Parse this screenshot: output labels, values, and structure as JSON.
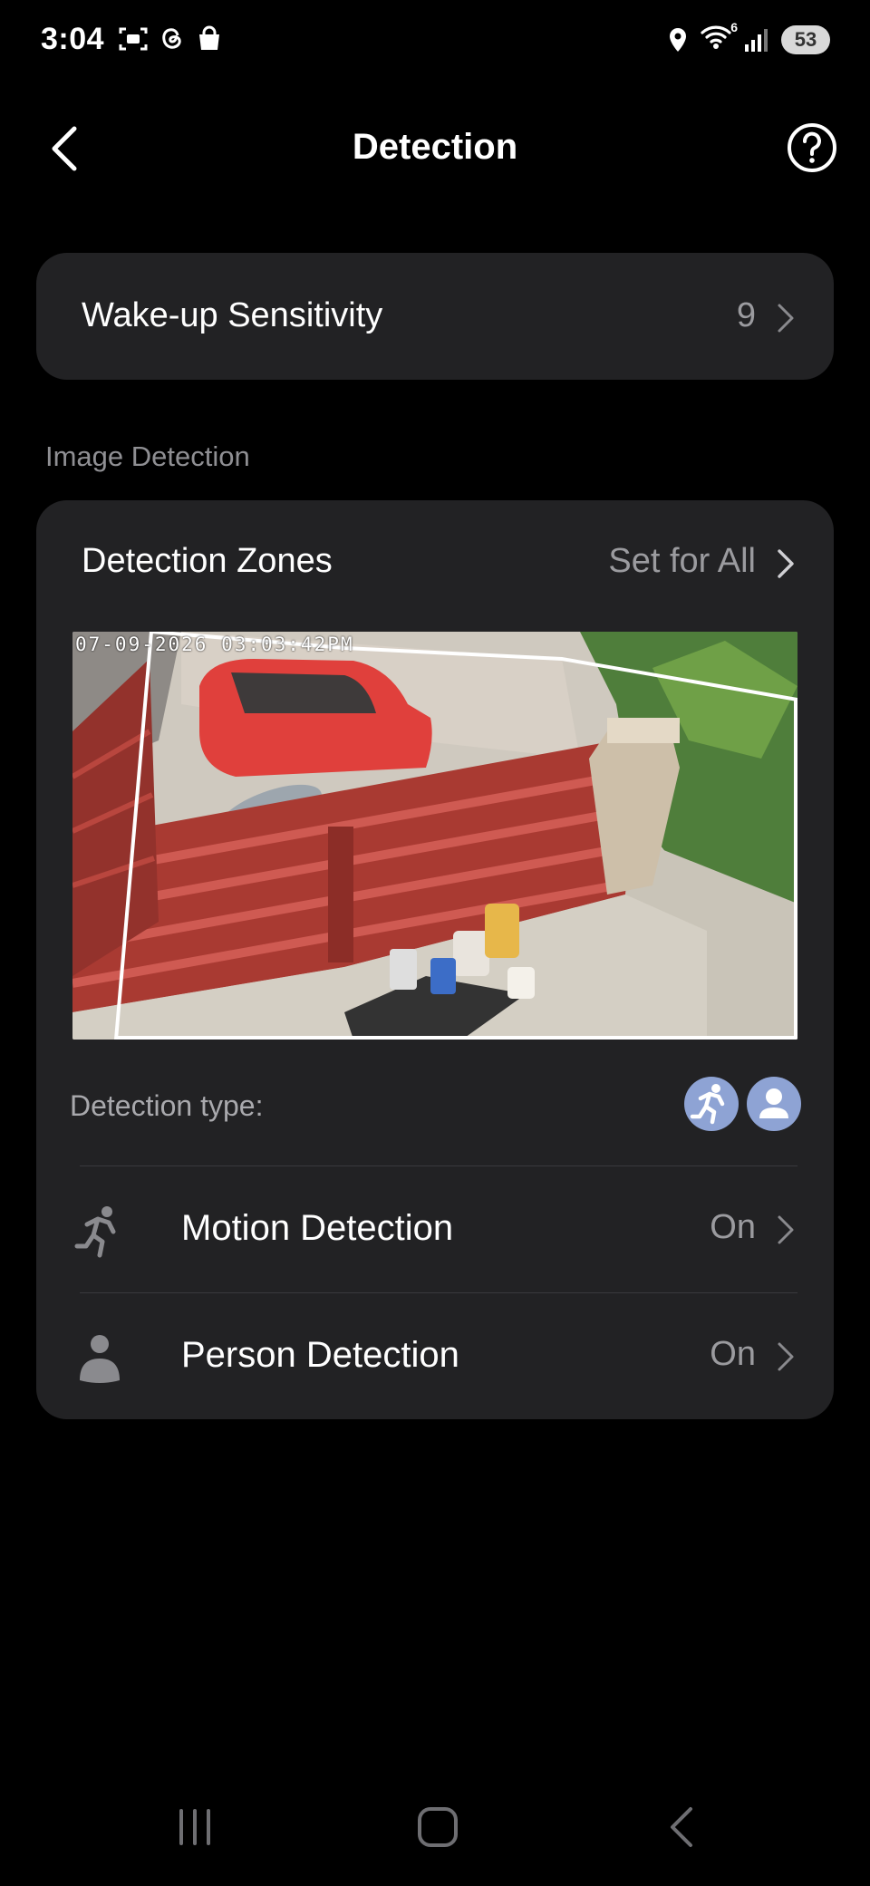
{
  "status_bar": {
    "time": "3:04",
    "battery": "53",
    "wifi_superscript": "6"
  },
  "header": {
    "title": "Detection"
  },
  "wakeup": {
    "label": "Wake-up Sensitivity",
    "value": "9"
  },
  "image_detection": {
    "section_label": "Image Detection",
    "zones_label": "Detection Zones",
    "zones_action": "Set for All",
    "camera_timestamp": "07-09-2026 03:03:42PM",
    "type_label": "Detection type:",
    "rows": [
      {
        "label": "Motion Detection",
        "value": "On",
        "icon": "running-person-icon"
      },
      {
        "label": "Person Detection",
        "value": "On",
        "icon": "person-icon"
      }
    ]
  },
  "colors": {
    "background": "#000000",
    "card": "#222224",
    "secondary_text": "#9b9b9f",
    "badge": "#8ea3d4"
  }
}
